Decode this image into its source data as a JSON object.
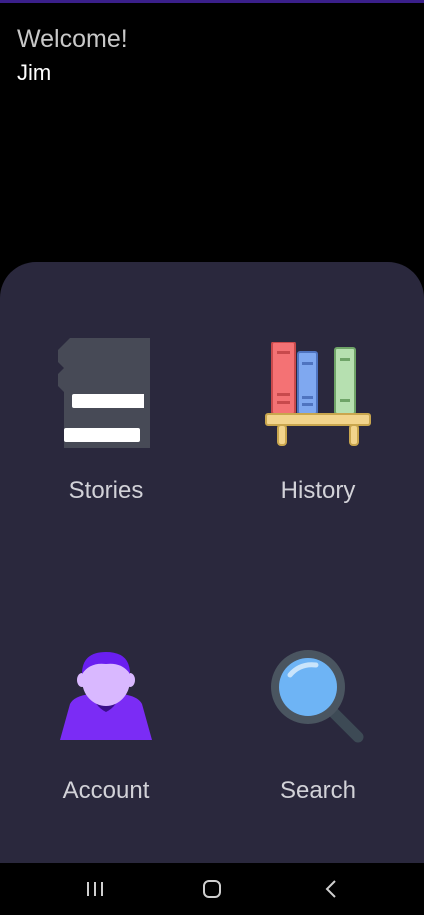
{
  "header": {
    "greeting": "Welcome!",
    "username": "Jim"
  },
  "menu": {
    "tiles": [
      {
        "label": "Stories",
        "icon": "books-stack-icon"
      },
      {
        "label": "History",
        "icon": "bookshelf-icon"
      },
      {
        "label": "Account",
        "icon": "user-avatar-icon"
      },
      {
        "label": "Search",
        "icon": "magnifier-icon"
      }
    ]
  },
  "navbar": {
    "items": [
      "recent-apps-icon",
      "home-icon",
      "back-icon"
    ]
  },
  "colors": {
    "background": "#000000",
    "panel": "#2a283d",
    "accent": "#6a1ff0",
    "label": "#d2d2d8"
  }
}
